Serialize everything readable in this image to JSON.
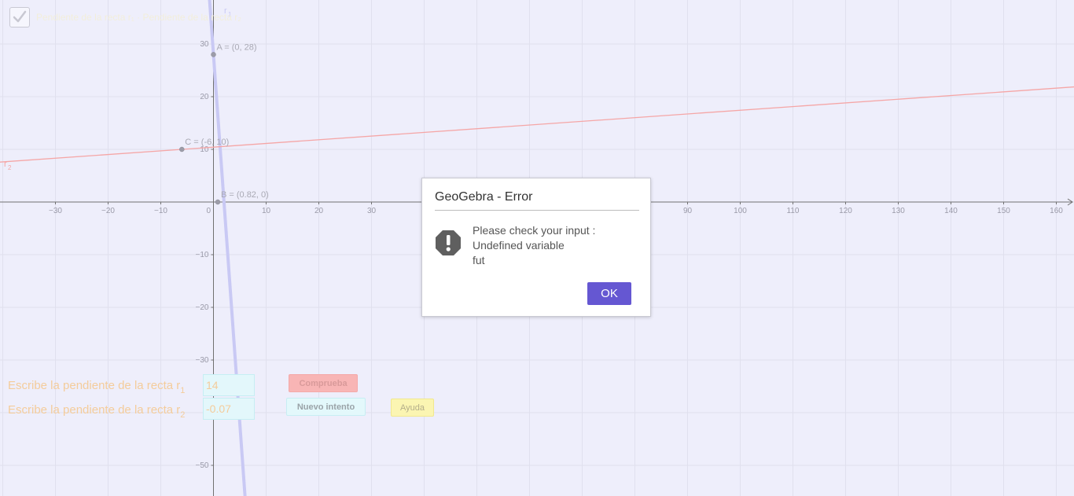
{
  "window": {
    "checkbox_label": "Pendiente de la recta r₁ · Pendiente de la recta r₂"
  },
  "graph": {
    "x_axis": {
      "min": -40,
      "max": 163,
      "tick_labels": [
        "−30",
        "−20",
        "−10",
        "0",
        "10",
        "20",
        "30",
        "90",
        "100",
        "110",
        "120",
        "130",
        "140",
        "150",
        "160"
      ]
    },
    "y_axis": {
      "min": -56,
      "max": 38,
      "tick_labels": [
        "30",
        "20",
        "10",
        "−10",
        "−20",
        "−30",
        "−50"
      ]
    },
    "points": [
      {
        "name": "A",
        "x": 0,
        "y": 28,
        "label": "A = (0, 28)"
      },
      {
        "name": "B",
        "x": 0.82,
        "y": 0,
        "label": "B = (0.82, 0)"
      },
      {
        "name": "C",
        "x": -6,
        "y": 10,
        "label": "C = (-6, 10)"
      }
    ],
    "lines": [
      {
        "name": "r1",
        "label_main": "r",
        "label_sub": "1",
        "slope": -14,
        "through": [
          0,
          28
        ],
        "color": "#c9c9f4"
      },
      {
        "name": "r2",
        "label_main": "r",
        "label_sub": "2",
        "slope": 0.07,
        "through": [
          -6,
          10
        ],
        "color": "#f5a6a6"
      }
    ],
    "colors": {
      "background": "#eeeefb",
      "grid": "#e0e0ee",
      "axis": "#707070",
      "r1": "#c9c9f4",
      "r2": "#f5a6a6"
    }
  },
  "slope_questions": [
    {
      "prefix": "Escribe la pendiente de la recta r",
      "sub": "1",
      "value": "14"
    },
    {
      "prefix": "Escribe la pendiente de la recta r",
      "sub": "2",
      "value": "-0.07"
    }
  ],
  "buttons": {
    "check": "Comprueba",
    "retry": "Nuevo intento",
    "help": "Ayuda"
  },
  "dialog": {
    "title": "GeoGebra - Error",
    "icon": "exclamation-icon",
    "message_lines": [
      "Please check your input :",
      "Undefined variable",
      "fut"
    ],
    "ok_label": "OK"
  }
}
